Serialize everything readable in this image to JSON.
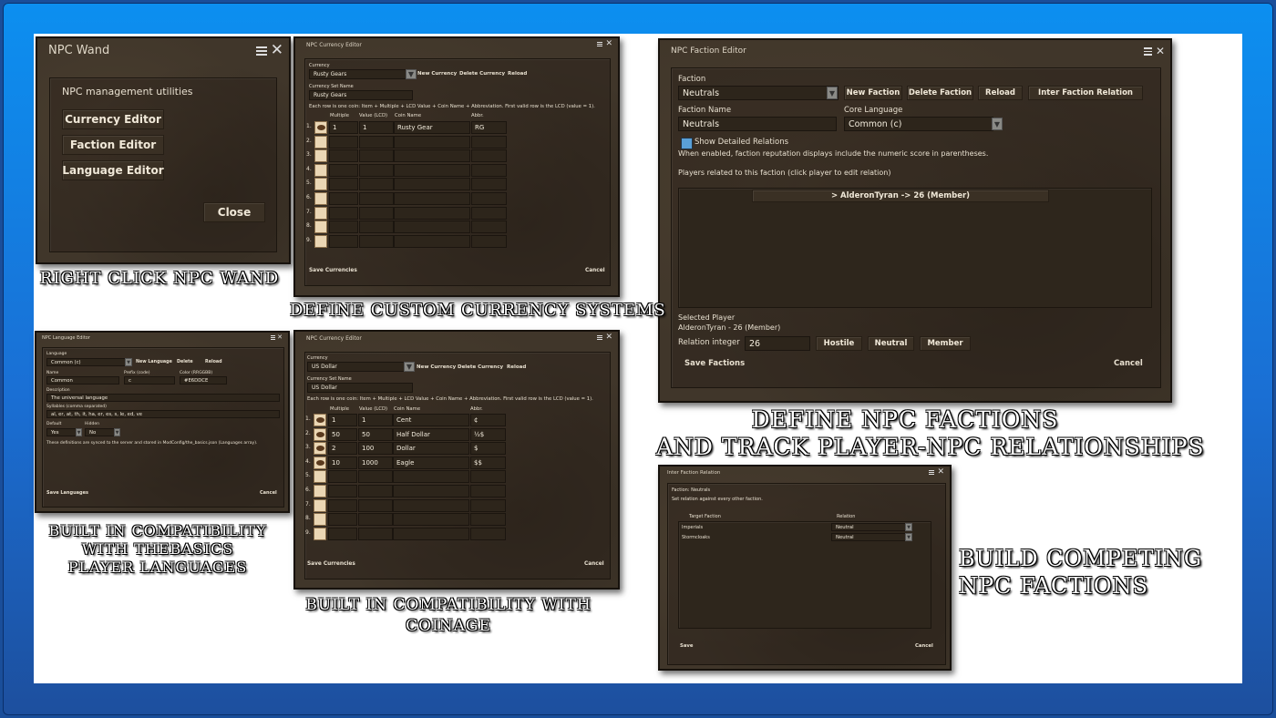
{
  "colors": {
    "frame": "#1a6fd4",
    "window": "#40362a",
    "slot": "#ead6b4"
  },
  "wand": {
    "title": "NPC Wand",
    "subtitle": "NPC management utilities",
    "currency": "Currency Editor",
    "faction": "Faction Editor",
    "language": "Language Editor",
    "close": "Close"
  },
  "currency1": {
    "title": "NPC Currency Editor",
    "currency_label": "Currency",
    "currency_value": "Rusty Gears",
    "new": "New Currency",
    "delete": "Delete Currency",
    "reload": "Reload",
    "setname_label": "Currency Set Name",
    "setname_value": "Rusty Gears",
    "note": "Each row is one coin: Item + Multiple + LCD Value + Coin Name + Abbreviation. First valid row is the LCD (value = 1).",
    "cols": [
      "Multiple",
      "Value (LCD)",
      "Coin Name",
      "Abbr."
    ],
    "rows": [
      [
        "1",
        "1",
        "Rusty Gear",
        "RG"
      ]
    ],
    "save": "Save Currencies",
    "cancel": "Cancel"
  },
  "currency2": {
    "title": "NPC Currency Editor",
    "currency_label": "Currency",
    "currency_value": "US Dollar",
    "new": "New Currency",
    "delete": "Delete Currency",
    "reload": "Reload",
    "setname_label": "Currency Set Name",
    "setname_value": "US Dollar",
    "note": "Each row is one coin: Item + Multiple + LCD Value + Coin Name + Abbreviation. First valid row is the LCD (value = 1).",
    "cols": [
      "Multiple",
      "Value (LCD)",
      "Coin Name",
      "Abbr."
    ],
    "rows": [
      [
        "1",
        "1",
        "Cent",
        "¢"
      ],
      [
        "50",
        "50",
        "Half Dollar",
        "½$"
      ],
      [
        "2",
        "100",
        "Dollar",
        "$"
      ],
      [
        "10",
        "1000",
        "Eagle",
        "$$"
      ]
    ],
    "save": "Save Currencies",
    "cancel": "Cancel"
  },
  "row_numbers": [
    "1.",
    "2.",
    "3.",
    "4.",
    "5.",
    "6.",
    "7.",
    "8.",
    "9."
  ],
  "faction": {
    "title": "NPC Faction Editor",
    "faction_label": "Faction",
    "faction_value": "Neutrals",
    "new": "New Faction",
    "delete": "Delete Faction",
    "reload": "Reload",
    "inter": "Inter Faction Relation",
    "name_label": "Faction Name",
    "name_value": "Neutrals",
    "lang_label": "Core Language",
    "lang_value": "Common (c)",
    "show": "Show Detailed Relations",
    "show_note": "When enabled, faction reputation displays include the numeric score in parentheses.",
    "players_label": "Players related to this faction (click player to edit relation)",
    "player_item": "> AlderonTyran -> 26 (Member)",
    "selected_label": "Selected Player",
    "selected_value": "AlderonTyran - 26 (Member)",
    "relint_label": "Relation integer",
    "relint_value": "26",
    "hostile": "Hostile",
    "neutral": "Neutral",
    "member": "Member",
    "save": "Save Factions",
    "cancel": "Cancel"
  },
  "language": {
    "title": "NPC Language Editor",
    "language_label": "Language",
    "language_value": "Common (c)",
    "new": "New Language",
    "delete": "Delete",
    "reload": "Reload",
    "name_label": "Name",
    "name_value": "Common",
    "prefix_label": "Prefix (code)",
    "prefix_value": "c",
    "color_label": "Color (RRGGBB)",
    "color_value": "#E6DDCE",
    "desc_label": "Description",
    "desc_value": "The universal language",
    "syl_label": "Syllables (comma separated)",
    "syl_value": "al, er, at, th, it, ha, er, es, s, le, ed, ve",
    "default_label": "Default",
    "default_value": "Yes",
    "hidden_label": "Hidden",
    "hidden_value": "No",
    "note": "These definitions are synced to the server and stored in ModConfig/the_basics.json (Languages array).",
    "save": "Save Languages",
    "cancel": "Cancel"
  },
  "inter": {
    "title": "Inter Faction Relation",
    "faction_line": "Faction: Neutrals",
    "note": "Set relation against every other faction.",
    "col_target": "Target Faction",
    "col_relation": "Relation",
    "rows": [
      [
        "Imperials",
        "Neutral"
      ],
      [
        "Stormcloaks",
        "Neutral"
      ]
    ],
    "save": "Save",
    "cancel": "Cancel"
  },
  "captions": {
    "wand": "RIGHT CLICK NPC WAND",
    "currency": "DEFINE CUSTOM CURRENCY SYSTEMS",
    "faction_1": "DEFINE NPC FACTIONS",
    "faction_2": "AND TRACK PLAYER-NPC RELATIONSHIPS",
    "lang_1": "BUILT IN COMPATIBILITY",
    "lang_2": "WITH THEBASICS",
    "lang_3": "PLAYER LANGUAGES",
    "coin_1": "BUILT IN COMPATIBILITY WITH",
    "coin_2": "COINAGE",
    "build_1": "BUILD COMPETING",
    "build_2": "NPC FACTIONS"
  }
}
